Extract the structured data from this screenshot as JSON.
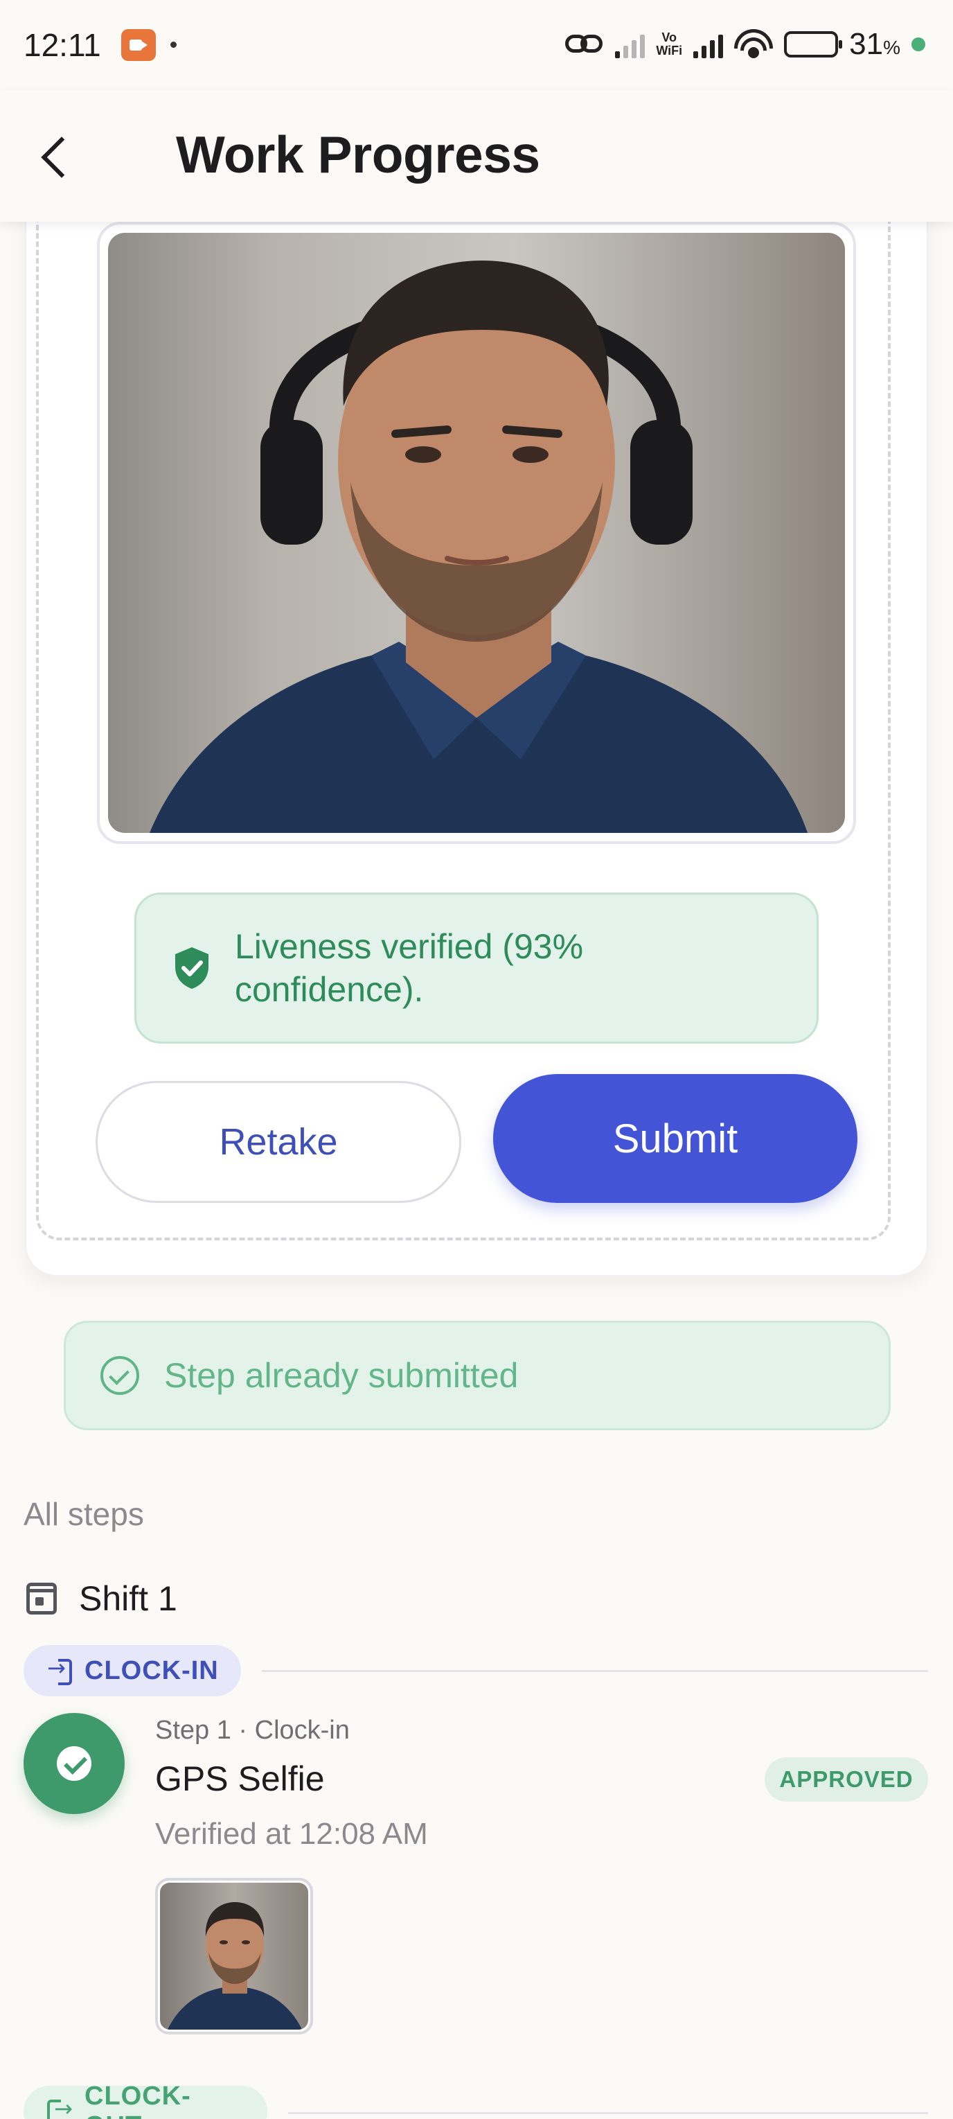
{
  "status_bar": {
    "time": "12:11",
    "vowifi": "Vo\nWiFi",
    "battery_pct": "31",
    "battery_unit": "%",
    "battery_level": 0.31
  },
  "header": {
    "title": "Work Progress"
  },
  "capture": {
    "liveness_text": "Liveness verified (93% confidence).",
    "retake_label": "Retake",
    "submit_label": "Submit"
  },
  "submitted_notice": "Step already submitted",
  "steps": {
    "section_label": "All steps",
    "shift_label": "Shift 1",
    "clock_in_label": "CLOCK-IN",
    "clock_out_label": "CLOCK-OUT",
    "items": [
      {
        "meta": "Step 1 · Clock-in",
        "title": "GPS Selfie",
        "status": "APPROVED",
        "verified": "Verified at 12:08 AM"
      }
    ]
  },
  "colors": {
    "accent": "#4355d6",
    "success": "#3e9a6a",
    "success_bg": "#e3f2ea"
  },
  "icons": [
    "back-arrow-icon",
    "shield-check-icon",
    "check-circle-icon",
    "calendar-icon",
    "login-icon",
    "logout-icon",
    "check-icon"
  ]
}
